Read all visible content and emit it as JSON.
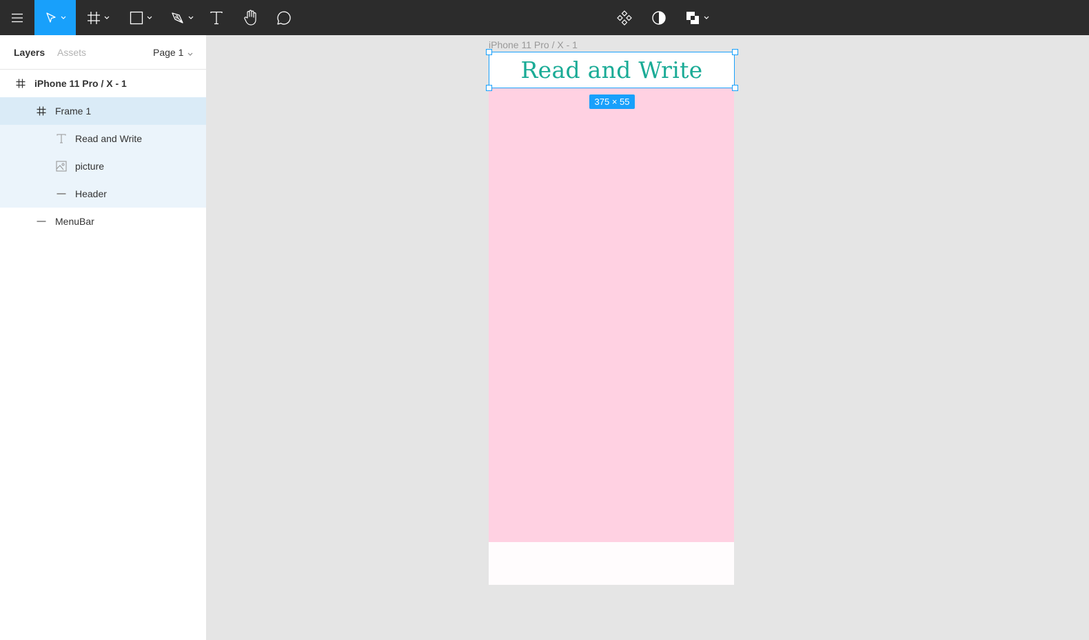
{
  "toolbar": {
    "left_tools": [
      {
        "name": "menu-icon"
      },
      {
        "name": "move-icon",
        "active": true
      },
      {
        "name": "frame-icon"
      },
      {
        "name": "rectangle-icon"
      },
      {
        "name": "pen-icon"
      },
      {
        "name": "text-icon"
      },
      {
        "name": "hand-icon"
      },
      {
        "name": "comment-icon"
      }
    ],
    "center_tools": [
      {
        "name": "component-icon"
      },
      {
        "name": "mask-icon"
      },
      {
        "name": "boolean-icon"
      }
    ],
    "active_color": "#18a0fb",
    "background": "#2c2c2c"
  },
  "sidebar": {
    "tabs": [
      {
        "label": "Layers",
        "active": true
      },
      {
        "label": "Assets",
        "active": false
      }
    ],
    "page_selector": "Page 1",
    "layers": [
      {
        "label": "iPhone 11 Pro / X - 1",
        "icon": "frame-icon",
        "depth": 0
      },
      {
        "label": "Frame 1",
        "icon": "frame-icon",
        "depth": 1,
        "selected": true
      },
      {
        "label": "Read and Write",
        "icon": "text-icon",
        "depth": 2
      },
      {
        "label": "picture",
        "icon": "image-icon",
        "depth": 2
      },
      {
        "label": "Header",
        "icon": "rectangle-line-icon",
        "depth": 2
      },
      {
        "label": "MenuBar",
        "icon": "rectangle-line-icon",
        "depth": 1
      }
    ]
  },
  "canvas": {
    "frame_title": "iPhone 11 Pro / X - 1",
    "header_text": "Read and Write",
    "selection_size": "375 × 55",
    "colors": {
      "canvas_bg": "#e5e5e5",
      "phone_pink": "#ffd1e2",
      "menubar_white": "#fffcfd",
      "header_text": "#1aab96",
      "selection": "#18a0fb"
    }
  }
}
